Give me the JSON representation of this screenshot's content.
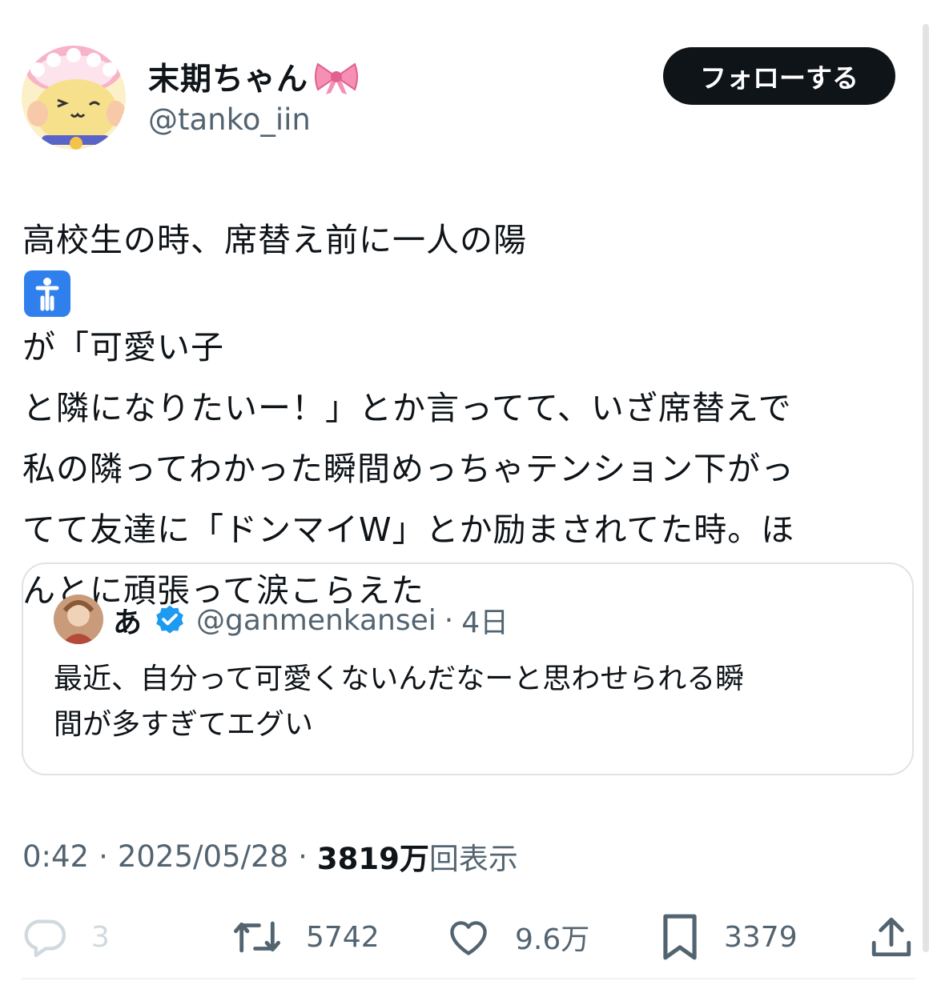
{
  "user": {
    "display_name": "末期ちゃん",
    "handle": "@tanko_iin",
    "follow_label": "フォローする"
  },
  "tweet": {
    "lines": [
      "高校生の時、席替え前に一人の陽",
      "が「可愛い子",
      "と隣になりたいー！」とか言ってて、いざ席替えで",
      "私の隣ってわかった瞬間めっちゃテンション下がっ",
      "てて友達に「ドンマイW」とか励まされてた時。ほ",
      "んとに頑張って涙こらえた"
    ]
  },
  "quote": {
    "name": "あ",
    "handle": "@ganmenkansei",
    "dot": "·",
    "time": "4日",
    "lines": [
      "最近、自分って可愛くないんだなーと思わせられる瞬",
      "間が多すぎてエグい"
    ]
  },
  "meta": {
    "time": "0:42",
    "sep1": "·",
    "date": "2025/05/28",
    "sep2": "·",
    "views_number": "3819万",
    "views_label": "回表示"
  },
  "actions": {
    "reply_count": "3",
    "retweet_count": "5742",
    "like_count": "9.6万",
    "bookmark_count": "3379"
  },
  "icons": {
    "reply": "reply-icon",
    "retweet": "retweet-icon",
    "like": "heart-icon",
    "bookmark": "bookmark-icon",
    "share": "share-icon",
    "verified": "verified-badge-icon",
    "bow": "ribbon-emoji-icon",
    "person": "person-emoji-icon"
  },
  "colors": {
    "text": "#0f1419",
    "secondary": "#536471",
    "follow_bg": "#0f1419",
    "verified": "#1d9bf0",
    "emoji_person_bg": "#2f80ed",
    "bow_pink": "#f58fb4"
  }
}
